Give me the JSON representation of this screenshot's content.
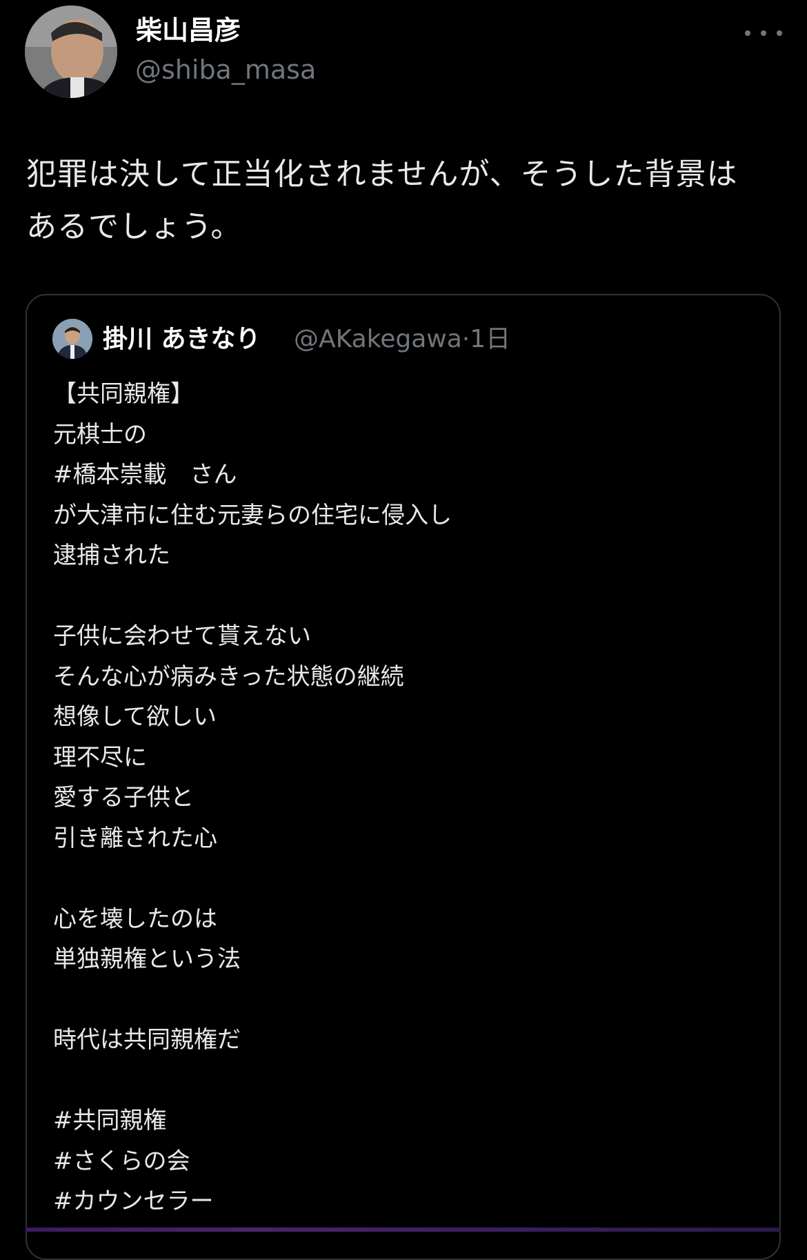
{
  "tweet": {
    "author": {
      "display_name": "柴山昌彦",
      "handle": "@shiba_masa",
      "avatar_icon": "user-avatar-photo"
    },
    "more_icon": "more-horizontal-icon",
    "text_lines": [
      "犯罪は決して正当化されませんが、そうした背景は",
      "あるでしょう。"
    ]
  },
  "quote": {
    "author": {
      "display_name": "掛川 あきなり",
      "handle": "@AKakegawa",
      "separator": "·",
      "time": "1日",
      "avatar_icon": "user-avatar-photo"
    },
    "lines": [
      "【共同親権】",
      "元棋士の",
      "#橋本崇載　さん",
      "が大津市に住む元妻らの住宅に侵入し",
      "逮捕された",
      "",
      "子供に会わせて貰えない",
      "そんな心が病みきった状態の継続",
      "想像して欲しい",
      "理不尽に",
      "愛する子供と",
      "引き離された心",
      "",
      "心を壊したのは",
      "単独親権という法",
      "",
      "時代は共同親権だ",
      "",
      "#共同親権",
      "#さくらの会",
      "#カウンセラー"
    ]
  },
  "colors": {
    "background": "#000000",
    "primary_text": "#e7e9ea",
    "secondary_text": "#71767b",
    "border": "#2f3336"
  }
}
